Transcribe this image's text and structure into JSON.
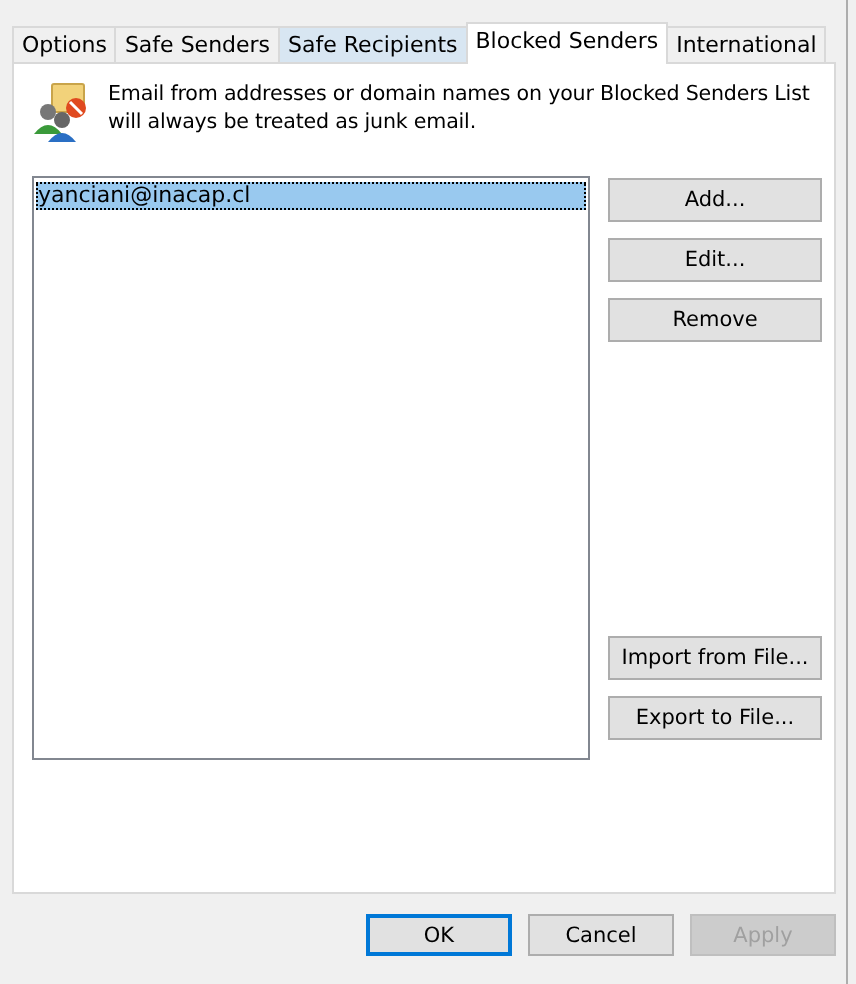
{
  "tabs": [
    {
      "label": "Options",
      "selected": false,
      "hovered": false
    },
    {
      "label": "Safe Senders",
      "selected": false,
      "hovered": false
    },
    {
      "label": "Safe Recipients",
      "selected": false,
      "hovered": true
    },
    {
      "label": "Blocked Senders",
      "selected": true,
      "hovered": false
    },
    {
      "label": "International",
      "selected": false,
      "hovered": false
    }
  ],
  "description": "Email from addresses or domain names on your Blocked Senders List will always be treated as junk email.",
  "list": [
    {
      "text": "yanciani@inacap.cl",
      "selected": true
    }
  ],
  "side_buttons": [
    {
      "label": "Add..."
    },
    {
      "label": "Edit..."
    },
    {
      "label": "Remove"
    },
    {
      "label": "Import from File..."
    },
    {
      "label": "Export to File..."
    }
  ],
  "dialog_buttons": [
    {
      "label": "OK",
      "default": true,
      "disabled": false
    },
    {
      "label": "Cancel",
      "default": false,
      "disabled": false
    },
    {
      "label": "Apply",
      "default": false,
      "disabled": true
    }
  ]
}
